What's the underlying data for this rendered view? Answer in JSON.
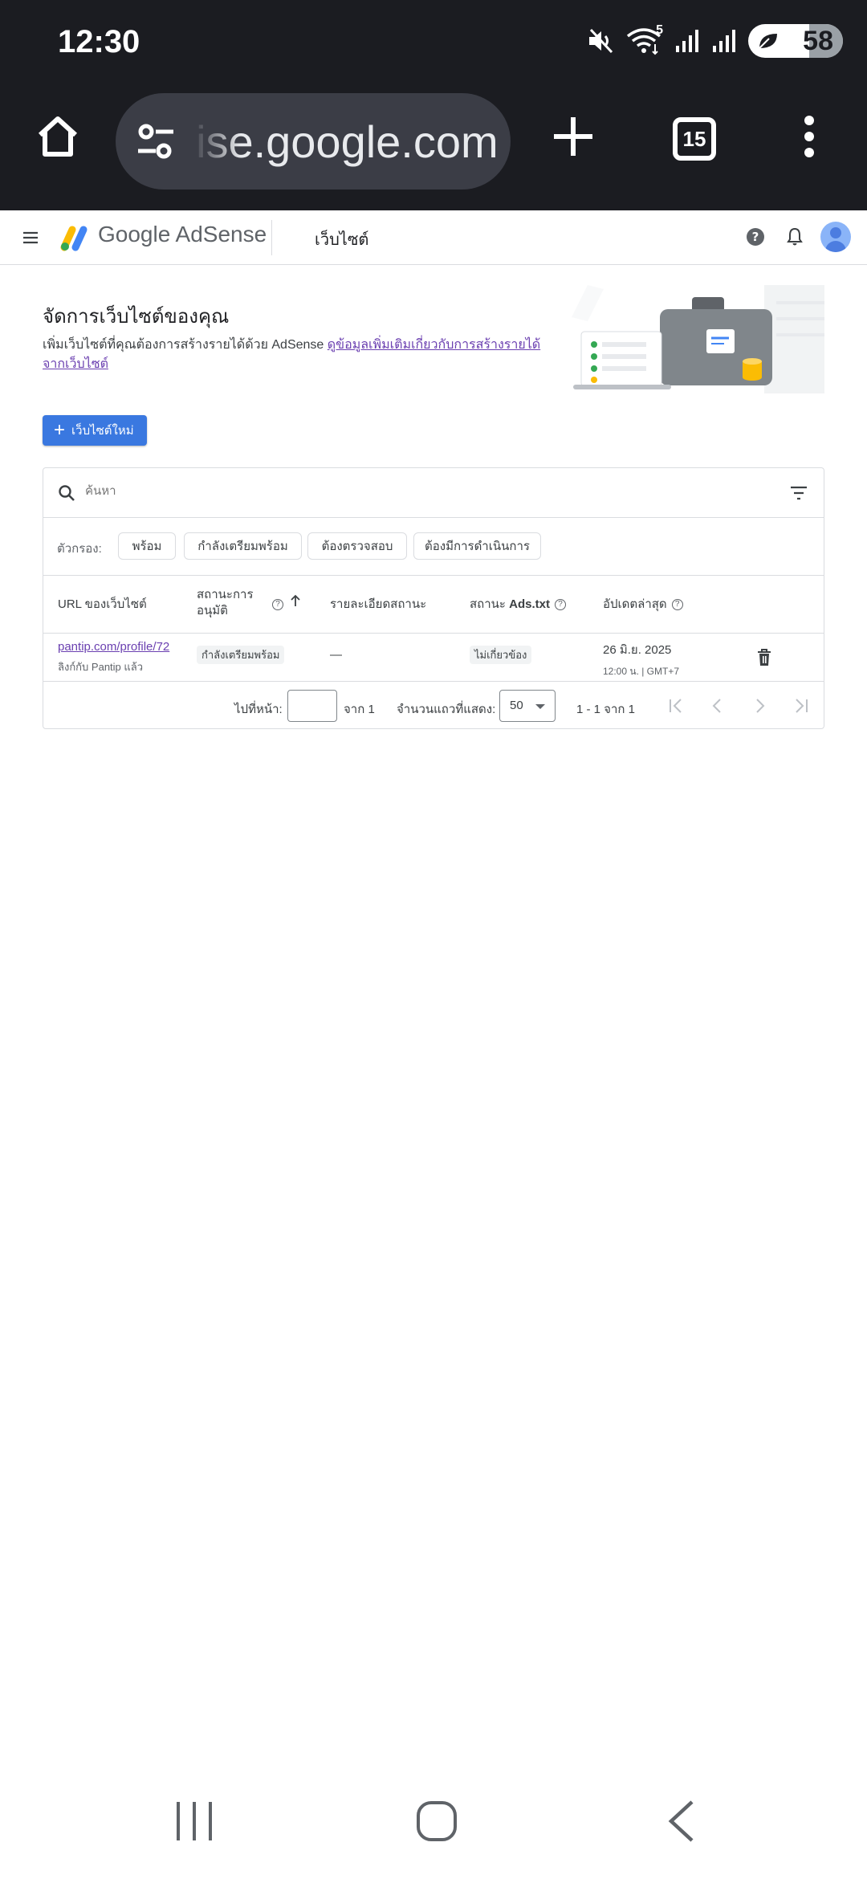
{
  "status_bar": {
    "time": "12:30",
    "wifi_badge": "5",
    "battery": "58"
  },
  "browser": {
    "url": "ise.google.com",
    "tab_count": "15"
  },
  "app_header": {
    "brand_google": "Google",
    "brand_product": "AdSense",
    "section": "เว็บไซต์"
  },
  "intro": {
    "title": "จัดการเว็บไซต์ของคุณ",
    "description": "เพิ่มเว็บไซต์ที่คุณต้องการสร้างรายได้ด้วย AdSense ",
    "learn_more": "ดูข้อมูลเพิ่มเติมเกี่ยวกับการสร้างรายได้จากเว็บไซต์"
  },
  "new_site_button": "เว็บไซต์ใหม่",
  "search": {
    "placeholder": "ค้นหา"
  },
  "filters": {
    "label": "ตัวกรอง:",
    "chips": [
      "พร้อม",
      "กำลังเตรียมพร้อม",
      "ต้องตรวจสอบ",
      "ต้องมีการดำเนินการ"
    ]
  },
  "table": {
    "headers": {
      "url": "URL ของเว็บไซต์",
      "approval_status_line1": "สถานะการ",
      "approval_status_line2": "อนุมัติ",
      "status_details": "รายละเอียดสถานะ",
      "ads_txt_prefix": "สถานะ ",
      "ads_txt_bold": "Ads.txt",
      "last_updated": "อัปเดตล่าสุด"
    },
    "rows": [
      {
        "url": "pantip.com/profile/72",
        "url_sub": "ลิงก์กับ Pantip แล้ว",
        "approval_status": "กำลังเตรียมพร้อม",
        "status_details": "—",
        "ads_txt": "ไม่เกี่ยวข้อง",
        "updated_date": "26 มิ.ย. 2025",
        "updated_time": "12:00 น. | GMT+7"
      }
    ]
  },
  "pagination": {
    "go_to_page": "ไปที่หน้า:",
    "of_pages": "จาก 1",
    "rows_per_page_label": "จำนวนแถวที่แสดง:",
    "rows_per_page": "50",
    "range": "1 - 1 จาก 1"
  }
}
